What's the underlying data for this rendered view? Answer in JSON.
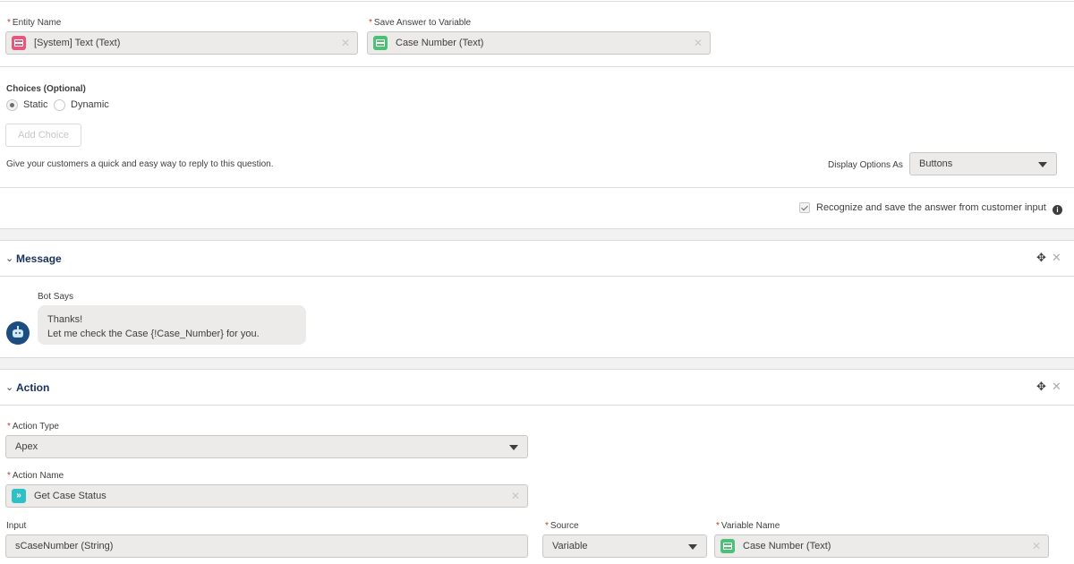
{
  "entity": {
    "label": "Entity Name",
    "value": "[System] Text (Text)",
    "icon": "text-entity-icon"
  },
  "save_variable": {
    "label": "Save Answer to Variable",
    "value": "Case Number (Text)",
    "icon": "variable-icon"
  },
  "choices": {
    "heading": "Choices (Optional)",
    "static_label": "Static",
    "dynamic_label": "Dynamic",
    "selected": "Static",
    "add_choice_label": "Add Choice",
    "helper_text": "Give your customers a quick and easy way to reply to this question.",
    "display_options_label": "Display Options As",
    "display_options_value": "Buttons"
  },
  "recognize": {
    "label": "Recognize and save the answer from customer input",
    "checked": true
  },
  "message_section": {
    "title": "Message",
    "bot_says_label": "Bot Says",
    "line1": "Thanks!",
    "line2": "Let me check the Case {!Case_Number} for you."
  },
  "action_section": {
    "title": "Action",
    "action_type_label": "Action Type",
    "action_type_value": "Apex",
    "action_name_label": "Action Name",
    "action_name_value": "Get Case Status",
    "input_label": "Input",
    "input_value": "sCaseNumber (String)",
    "source_label": "Source",
    "source_value": "Variable",
    "variable_name_label": "Variable Name",
    "variable_name_value": "Case Number (Text)"
  },
  "colors": {
    "entity_icon": "#e3587e",
    "variable_icon": "#4bc076",
    "action_icon": "#2fbfc7",
    "section_title": "#16325c",
    "required": "#c23934"
  }
}
